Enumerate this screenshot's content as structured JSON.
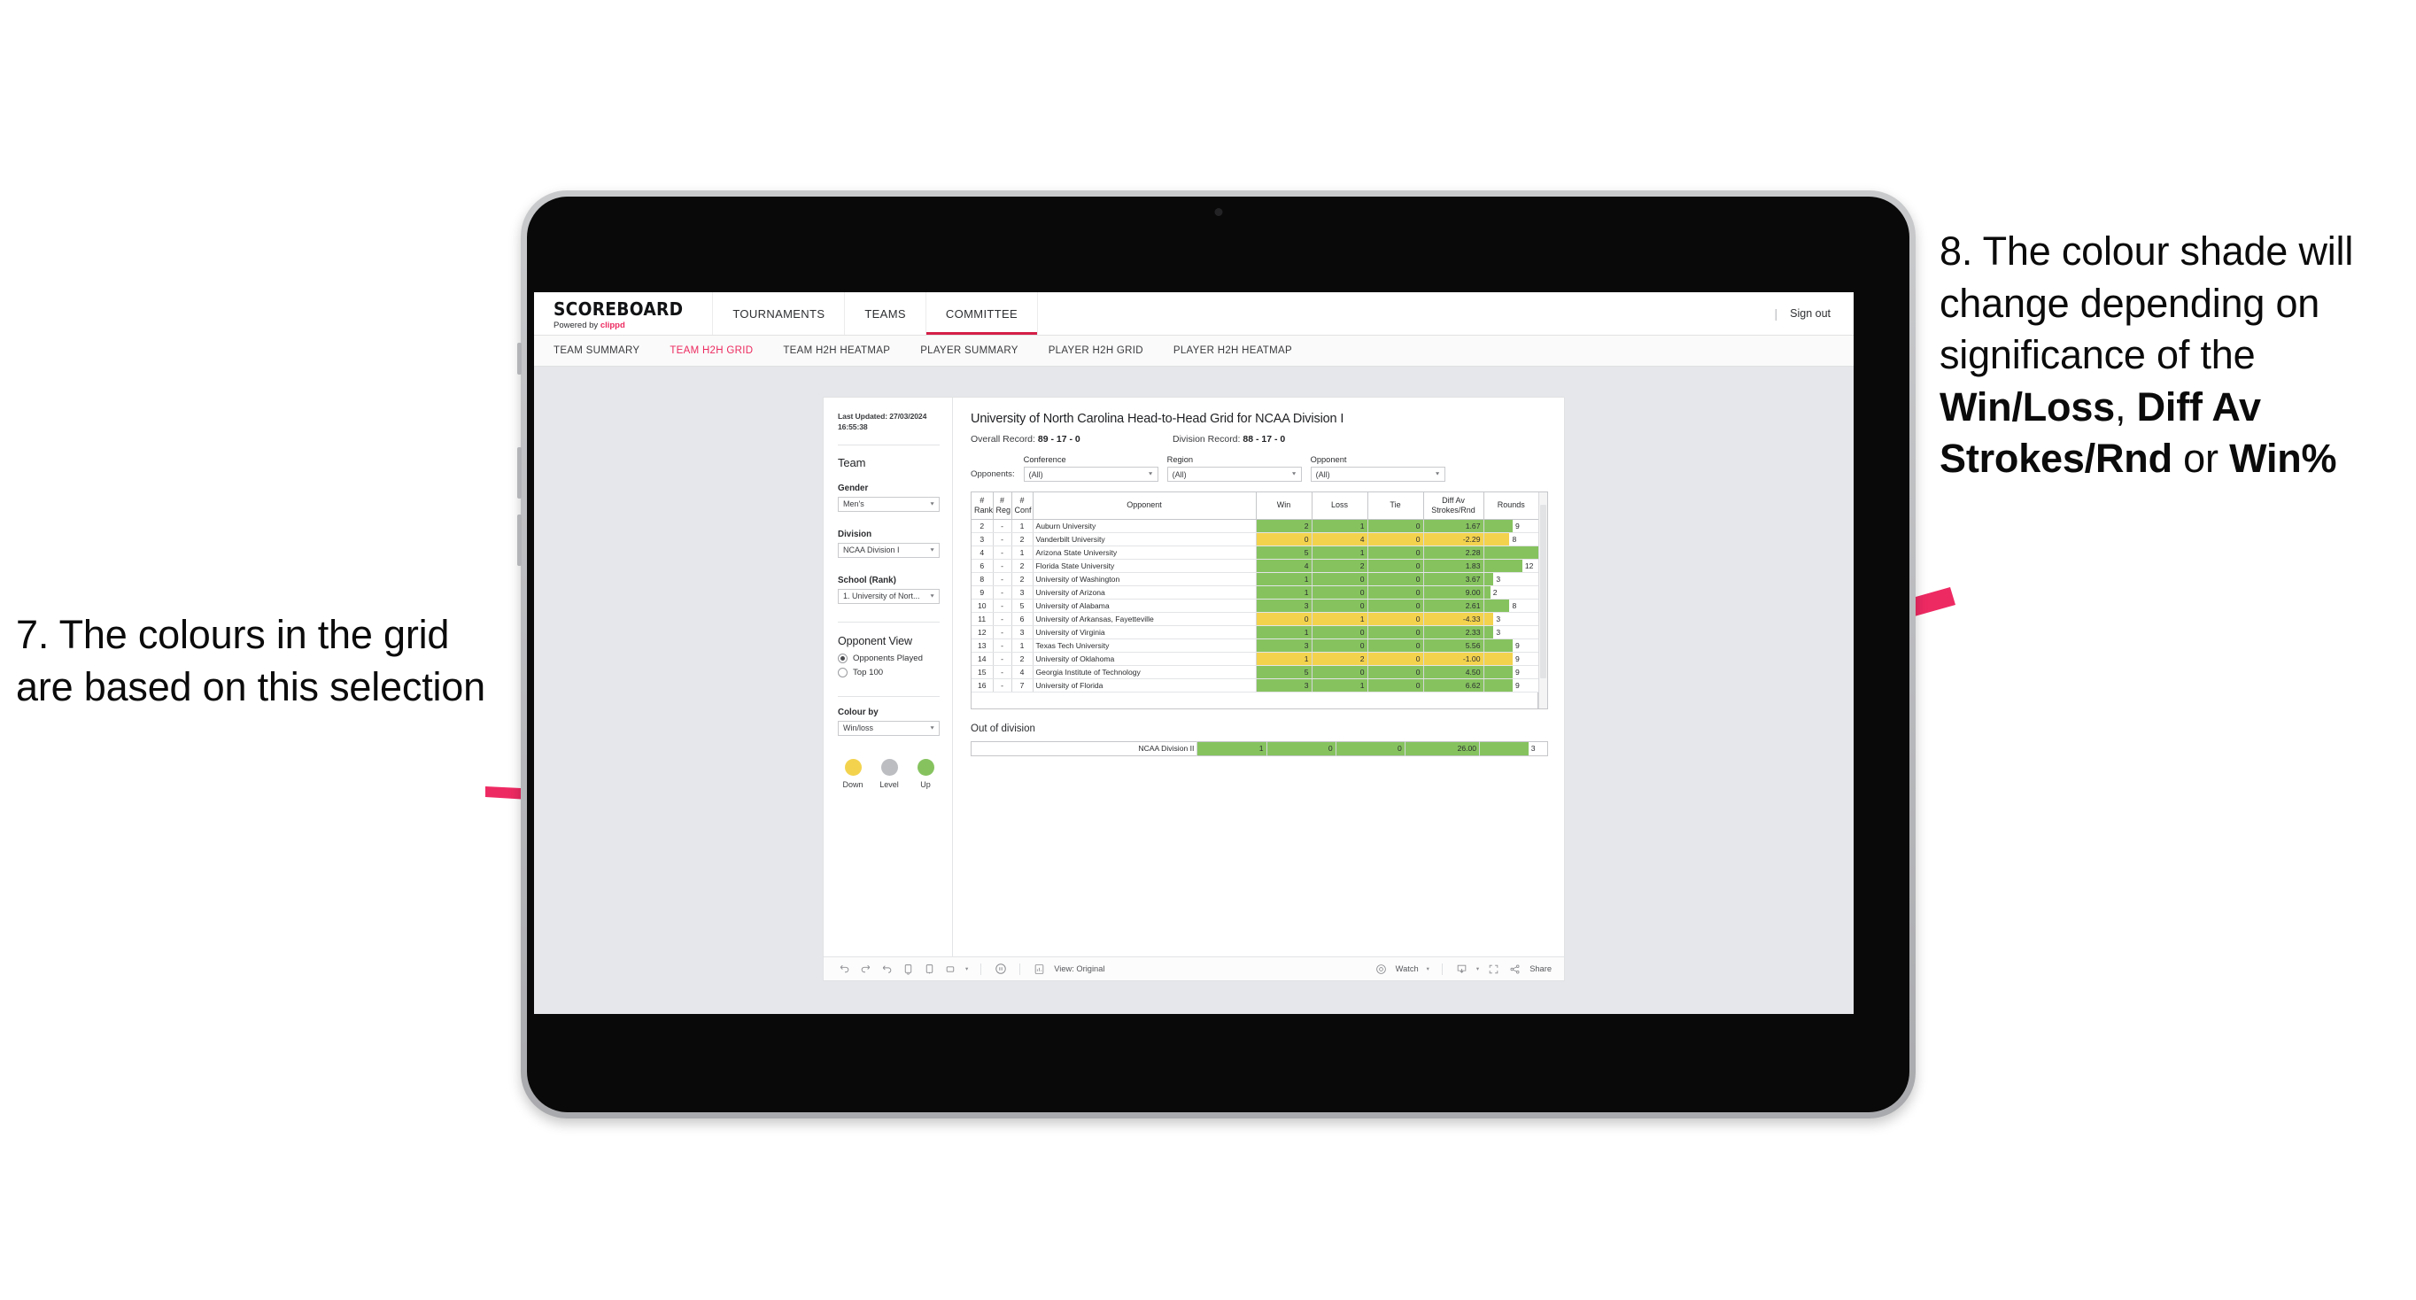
{
  "annotations": {
    "left": {
      "id": "7.",
      "text": "7. The colours in the grid are based on this selection"
    },
    "right": {
      "id": "8.",
      "prefix": "8. The colour shade will change depending on significance of the ",
      "bold1": "Win/Loss",
      "mid1": ", ",
      "bold2": "Diff Av Strokes/Rnd",
      "mid2": " or ",
      "bold3": "Win%"
    },
    "arrow_color": "#ee2a63"
  },
  "app": {
    "brand": {
      "title": "SCOREBOARD",
      "powered_by": "Powered by ",
      "clippd": "clippd"
    },
    "topnav": [
      {
        "label": "TOURNAMENTS",
        "active": false
      },
      {
        "label": "TEAMS",
        "active": false
      },
      {
        "label": "COMMITTEE",
        "active": true
      }
    ],
    "signout": "Sign out",
    "divider": "|",
    "subnav": [
      {
        "label": "TEAM SUMMARY",
        "active": false
      },
      {
        "label": "TEAM H2H GRID",
        "active": true
      },
      {
        "label": "TEAM H2H HEATMAP",
        "active": false
      },
      {
        "label": "PLAYER SUMMARY",
        "active": false
      },
      {
        "label": "PLAYER H2H GRID",
        "active": false
      },
      {
        "label": "PLAYER H2H HEATMAP",
        "active": false
      }
    ],
    "accent": "#ec2a5f"
  },
  "panel": {
    "last_updated": "Last Updated: 27/03/2024 16:55:38",
    "team_heading": "Team",
    "gender_label": "Gender",
    "gender_value": "Men's",
    "division_label": "Division",
    "division_value": "NCAA Division I",
    "school_label": "School (Rank)",
    "school_value": "1. University of Nort...",
    "opponent_view_heading": "Opponent View",
    "opponent_view_options": [
      {
        "label": "Opponents Played",
        "selected": true
      },
      {
        "label": "Top 100",
        "selected": false
      }
    ],
    "colour_by_label": "Colour by",
    "colour_by_value": "Win/loss",
    "legend": [
      {
        "label": "Down",
        "color": "#f3d34e"
      },
      {
        "label": "Level",
        "color": "#bcbdc1"
      },
      {
        "label": "Up",
        "color": "#86c35f"
      }
    ]
  },
  "viz": {
    "title": "University of North Carolina Head-to-Head Grid for NCAA Division I",
    "overall_record_label": "Overall Record: ",
    "overall_record_value": "89 - 17 - 0",
    "division_record_label": "Division Record: ",
    "division_record_value": "88 - 17 - 0",
    "opponents_label": "Opponents:",
    "filters": [
      {
        "label": "Conference",
        "value": "(All)"
      },
      {
        "label": "Region",
        "value": "(All)"
      },
      {
        "label": "Opponent",
        "value": "(All)"
      }
    ],
    "out_of_division_title": "Out of division"
  },
  "chart_data": {
    "type": "table",
    "title": "University of North Carolina Head-to-Head Grid for NCAA Division I",
    "columns": [
      "# Rank",
      "# Reg",
      "# Conf",
      "Opponent",
      "Win",
      "Loss",
      "Tie",
      "Diff Av Strokes/Rnd",
      "Rounds"
    ],
    "rounds_max": 17,
    "colors": {
      "up": "#86c35f",
      "down": "#f3d34e",
      "level": "#bcbdc1"
    },
    "rows": [
      {
        "rank": "2",
        "reg": "-",
        "conf": "1",
        "opponent": "Auburn University",
        "win": "2",
        "loss": "1",
        "tie": "0",
        "diff": "1.67",
        "rounds": "9",
        "state": "up"
      },
      {
        "rank": "3",
        "reg": "-",
        "conf": "2",
        "opponent": "Vanderbilt University",
        "win": "0",
        "loss": "4",
        "tie": "0",
        "diff": "-2.29",
        "rounds": "8",
        "state": "down"
      },
      {
        "rank": "4",
        "reg": "-",
        "conf": "1",
        "opponent": "Arizona State University",
        "win": "5",
        "loss": "1",
        "tie": "0",
        "diff": "2.28",
        "rounds": "17",
        "state": "up"
      },
      {
        "rank": "6",
        "reg": "-",
        "conf": "2",
        "opponent": "Florida State University",
        "win": "4",
        "loss": "2",
        "tie": "0",
        "diff": "1.83",
        "rounds": "12",
        "state": "up"
      },
      {
        "rank": "8",
        "reg": "-",
        "conf": "2",
        "opponent": "University of Washington",
        "win": "1",
        "loss": "0",
        "tie": "0",
        "diff": "3.67",
        "rounds": "3",
        "state": "up"
      },
      {
        "rank": "9",
        "reg": "-",
        "conf": "3",
        "opponent": "University of Arizona",
        "win": "1",
        "loss": "0",
        "tie": "0",
        "diff": "9.00",
        "rounds": "2",
        "state": "up"
      },
      {
        "rank": "10",
        "reg": "-",
        "conf": "5",
        "opponent": "University of Alabama",
        "win": "3",
        "loss": "0",
        "tie": "0",
        "diff": "2.61",
        "rounds": "8",
        "state": "up"
      },
      {
        "rank": "11",
        "reg": "-",
        "conf": "6",
        "opponent": "University of Arkansas, Fayetteville",
        "win": "0",
        "loss": "1",
        "tie": "0",
        "diff": "-4.33",
        "rounds": "3",
        "state": "down"
      },
      {
        "rank": "12",
        "reg": "-",
        "conf": "3",
        "opponent": "University of Virginia",
        "win": "1",
        "loss": "0",
        "tie": "0",
        "diff": "2.33",
        "rounds": "3",
        "state": "up"
      },
      {
        "rank": "13",
        "reg": "-",
        "conf": "1",
        "opponent": "Texas Tech University",
        "win": "3",
        "loss": "0",
        "tie": "0",
        "diff": "5.56",
        "rounds": "9",
        "state": "up"
      },
      {
        "rank": "14",
        "reg": "-",
        "conf": "2",
        "opponent": "University of Oklahoma",
        "win": "1",
        "loss": "2",
        "tie": "0",
        "diff": "-1.00",
        "rounds": "9",
        "state": "down"
      },
      {
        "rank": "15",
        "reg": "-",
        "conf": "4",
        "opponent": "Georgia Institute of Technology",
        "win": "5",
        "loss": "0",
        "tie": "0",
        "diff": "4.50",
        "rounds": "9",
        "state": "up"
      },
      {
        "rank": "16",
        "reg": "-",
        "conf": "7",
        "opponent": "University of Florida",
        "win": "3",
        "loss": "1",
        "tie": "0",
        "diff": "6.62",
        "rounds": "9",
        "state": "up"
      }
    ],
    "out_of_division": [
      {
        "opponent": "NCAA Division II",
        "win": "1",
        "loss": "0",
        "tie": "0",
        "diff": "26.00",
        "rounds": "3",
        "state": "up"
      }
    ]
  },
  "toolbar": {
    "view_label": "View: Original",
    "watch_label": "Watch",
    "share_label": "Share",
    "caret": "▾"
  }
}
